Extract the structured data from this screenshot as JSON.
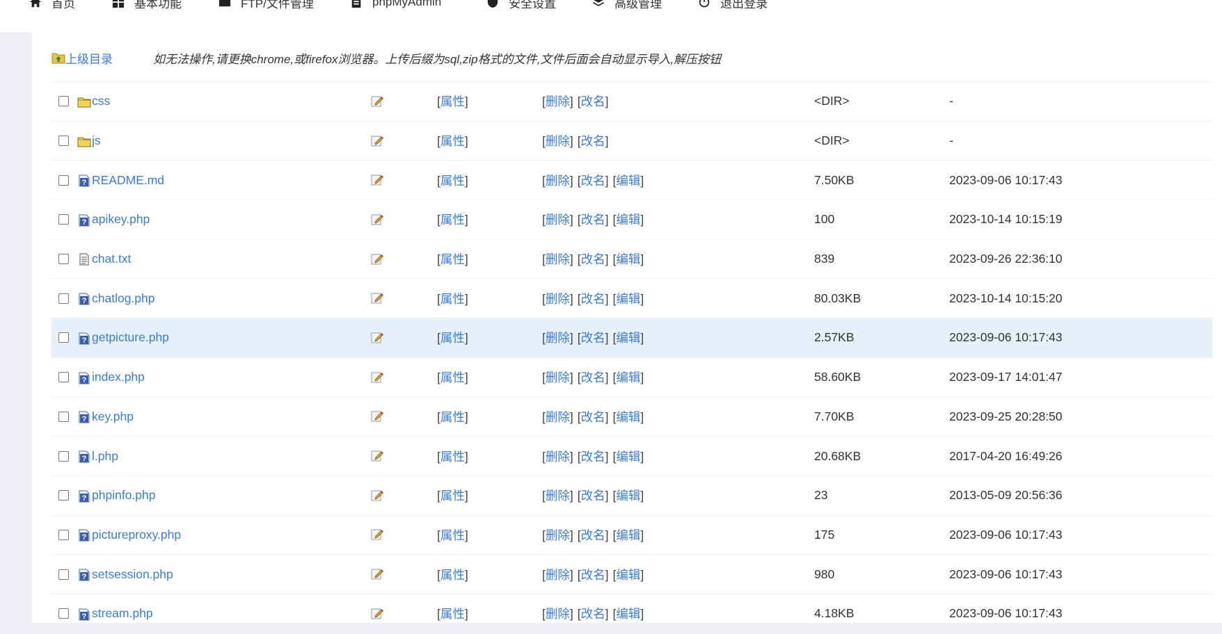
{
  "nav": {
    "items": [
      {
        "label": "首页",
        "icon": "home-icon"
      },
      {
        "label": "基本功能",
        "icon": "grid-icon"
      },
      {
        "label": "FTP/文件管理",
        "icon": "folder-icon"
      },
      {
        "label": "phpMyAdmin",
        "icon": "database-icon"
      },
      {
        "label": "安全设置",
        "icon": "shield-icon"
      },
      {
        "label": "高级管理",
        "icon": "layers-icon"
      },
      {
        "label": "退出登录",
        "icon": "power-icon"
      }
    ]
  },
  "toolbar": {
    "updir_label": "上级目录",
    "notice": "如无法操作,请更换chrome,或firefox浏览器。上传后缀为sql,zip格式的文件,文件后面会自动显示导入,解压按钮"
  },
  "actions": {
    "attr": "属性",
    "delete": "删除",
    "rename": "改名",
    "edit": "编辑",
    "open": "[",
    "close": "]"
  },
  "colors": {
    "link": "#3a7bd5",
    "highlight": "#e6f0fb"
  },
  "files": [
    {
      "name": "css",
      "type": "dir",
      "size": "<DIR>",
      "time": "-"
    },
    {
      "name": "js",
      "type": "dir",
      "size": "<DIR>",
      "time": "-"
    },
    {
      "name": "README.md",
      "type": "unknown",
      "size": "7.50KB",
      "time": "2023-09-06 10:17:43"
    },
    {
      "name": "apikey.php",
      "type": "unknown",
      "size": "100",
      "time": "2023-10-14 10:15:19"
    },
    {
      "name": "chat.txt",
      "type": "text",
      "size": "839",
      "time": "2023-09-26 22:36:10"
    },
    {
      "name": "chatlog.php",
      "type": "unknown",
      "size": "80.03KB",
      "time": "2023-10-14 10:15:20"
    },
    {
      "name": "getpicture.php",
      "type": "unknown",
      "size": "2.57KB",
      "time": "2023-09-06 10:17:43",
      "highlight": true
    },
    {
      "name": "index.php",
      "type": "unknown",
      "size": "58.60KB",
      "time": "2023-09-17 14:01:47"
    },
    {
      "name": "key.php",
      "type": "unknown",
      "size": "7.70KB",
      "time": "2023-09-25 20:28:50"
    },
    {
      "name": "l.php",
      "type": "unknown",
      "size": "20.68KB",
      "time": "2017-04-20 16:49:26"
    },
    {
      "name": "phpinfo.php",
      "type": "unknown",
      "size": "23",
      "time": "2013-05-09 20:56:36"
    },
    {
      "name": "pictureproxy.php",
      "type": "unknown",
      "size": "175",
      "time": "2023-09-06 10:17:43"
    },
    {
      "name": "setsession.php",
      "type": "unknown",
      "size": "980",
      "time": "2023-09-06 10:17:43"
    },
    {
      "name": "stream.php",
      "type": "unknown",
      "size": "4.18KB",
      "time": "2023-09-06 10:17:43"
    }
  ]
}
